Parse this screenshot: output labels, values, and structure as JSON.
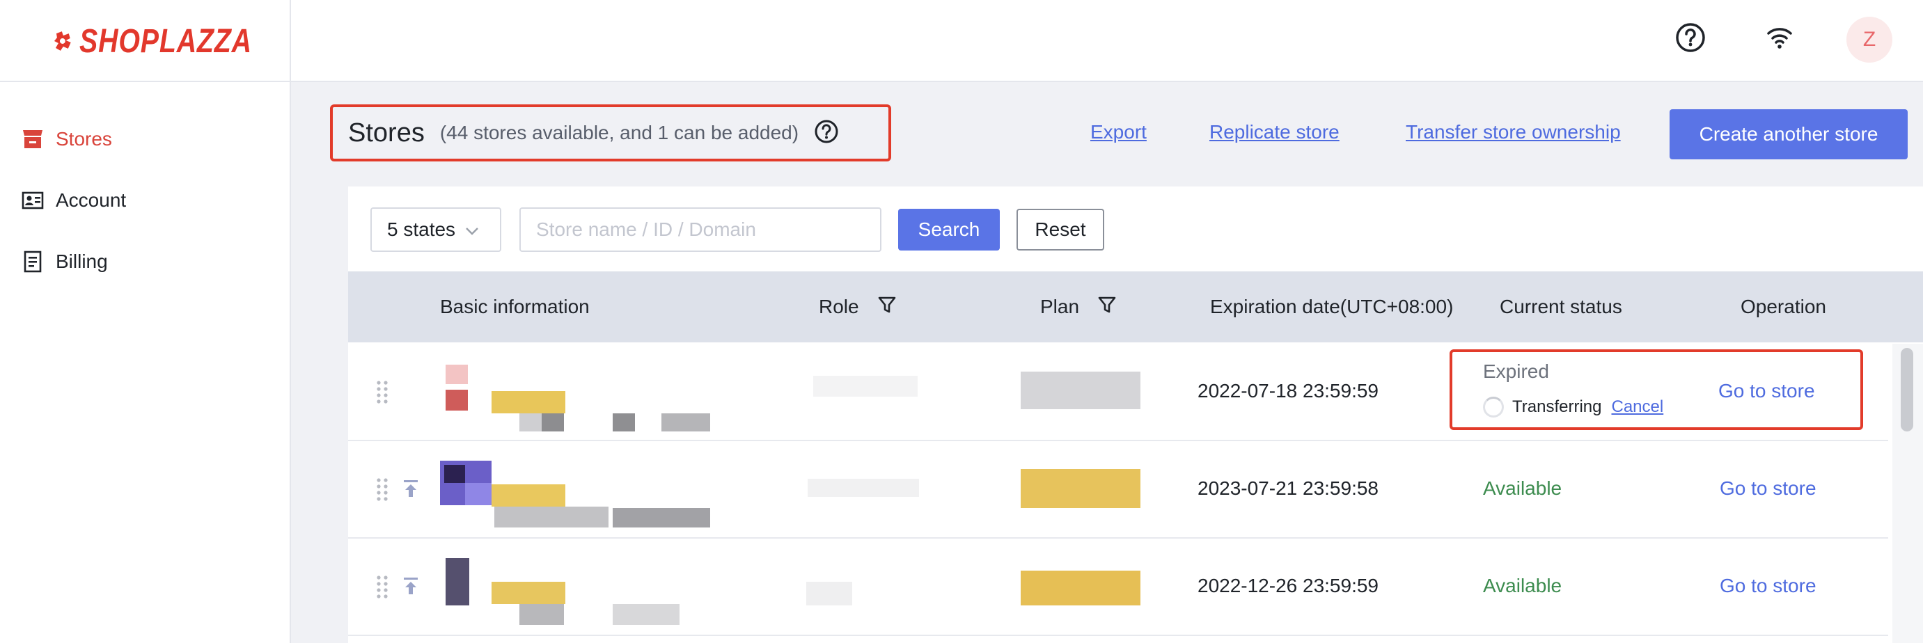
{
  "app": {
    "brand": "SHOPLAZZA",
    "avatar_initial": "Z",
    "accent_color": "#5a74e6",
    "brand_color": "#e2382c"
  },
  "sidebar": {
    "items": [
      {
        "label": "Stores",
        "icon": "store-icon",
        "active": true
      },
      {
        "label": "Account",
        "icon": "id-card-icon",
        "active": false
      },
      {
        "label": "Billing",
        "icon": "document-icon",
        "active": false
      }
    ]
  },
  "header": {
    "title": "Stores",
    "subtitle": "(44 stores available, and 1 can be added)",
    "links": {
      "export": "Export",
      "replicate": "Replicate store",
      "transfer": "Transfer store ownership"
    },
    "create_button": "Create another store"
  },
  "filters": {
    "states_select": "5 states",
    "search_placeholder": "Store name / ID / Domain",
    "search_button": "Search",
    "reset_button": "Reset"
  },
  "table": {
    "columns": {
      "basic": "Basic information",
      "role": "Role",
      "plan": "Plan",
      "expiration": "Expiration date(UTC+08:00)",
      "status": "Current status",
      "operation": "Operation"
    },
    "rows": [
      {
        "expiration": "2022-07-18 23:59:59",
        "status": "Expired",
        "transfer_status": "Transferring",
        "cancel_label": "Cancel",
        "operation": "Go to store"
      },
      {
        "expiration": "2023-07-21 23:59:58",
        "status": "Available",
        "operation": "Go to store"
      },
      {
        "expiration": "2022-12-26 23:59:59",
        "status": "Available",
        "operation": "Go to store"
      }
    ]
  }
}
